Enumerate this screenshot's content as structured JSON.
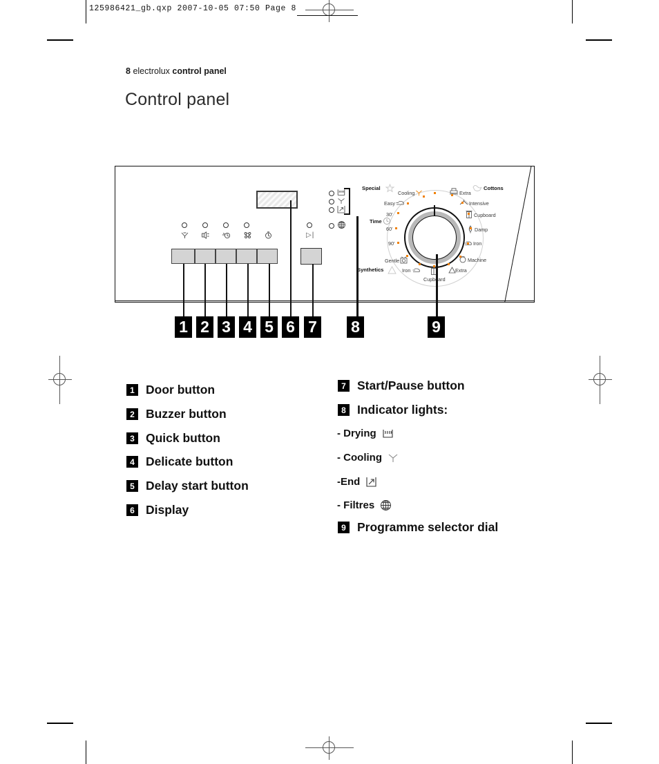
{
  "print_header": {
    "filename_line": "125986421_gb.qxp   2007-10-05   07:50   Page 8"
  },
  "page": {
    "page_number": "8",
    "brand": "electrolux",
    "breadcrumb_section": "control panel",
    "title": "Control panel"
  },
  "panel": {
    "buttons": [
      {
        "name": "door-button",
        "icon": "door-fan-icon"
      },
      {
        "name": "buzzer-button",
        "icon": "buzzer-speaker-icon"
      },
      {
        "name": "quick-button",
        "icon": "quick-clock-icon"
      },
      {
        "name": "delicate-button",
        "icon": "delicate-flower-icon"
      },
      {
        "name": "delay-start-button",
        "icon": "delay-timer-icon"
      }
    ],
    "start_pause": {
      "name": "start-pause-button",
      "glyph": "▷|"
    },
    "display": {
      "name": "display"
    },
    "indicator_lights": [
      {
        "label": "Drying",
        "icon": "drying-icon"
      },
      {
        "label": "Cooling",
        "icon": "cooling-fan-icon"
      },
      {
        "label": "End",
        "icon": "end-arrow-icon"
      },
      {
        "label": "Filtres",
        "icon": "filtres-mesh-icon"
      }
    ]
  },
  "dial": {
    "name": "programme-selector-dial",
    "left_labels": [
      {
        "text": "Special",
        "bold": true
      },
      {
        "text": "Cooling",
        "bold": false
      },
      {
        "text": "Easy",
        "bold": false
      },
      {
        "text": "Time",
        "bold": true
      },
      {
        "text": "30'",
        "bold": false
      },
      {
        "text": "60'",
        "bold": false
      },
      {
        "text": "90'",
        "bold": false
      },
      {
        "text": "Gentle",
        "bold": false
      },
      {
        "text": "Synthetics",
        "bold": true
      },
      {
        "text": "Iron",
        "bold": false
      }
    ],
    "right_labels": [
      {
        "text": "Cottons",
        "bold": true
      },
      {
        "text": "Extra",
        "bold": false
      },
      {
        "text": "Intensive",
        "bold": false
      },
      {
        "text": "Cupboard",
        "bold": false
      },
      {
        "text": "Damp",
        "bold": false
      },
      {
        "text": "Iron",
        "bold": false
      },
      {
        "text": "Machine",
        "bold": false
      },
      {
        "text": "Extra",
        "bold": false
      }
    ],
    "bottom_label": "Cupboard",
    "tick_color": "#f08000"
  },
  "callouts": [
    "1",
    "2",
    "3",
    "4",
    "5",
    "6",
    "7",
    "8",
    "9"
  ],
  "legend": {
    "left": [
      {
        "num": "1",
        "label": "Door button"
      },
      {
        "num": "2",
        "label": "Buzzer button"
      },
      {
        "num": "3",
        "label": "Quick button"
      },
      {
        "num": "4",
        "label": "Delicate button"
      },
      {
        "num": "5",
        "label": "Delay start button"
      },
      {
        "num": "6",
        "label": "Display"
      }
    ],
    "right": [
      {
        "num": "7",
        "label": "Start/Pause button"
      },
      {
        "num": "8",
        "label": "Indicator lights:"
      }
    ],
    "indicator_items": [
      {
        "label": "- Drying",
        "icon": "drying-icon"
      },
      {
        "label": "- Cooling",
        "icon": "cooling-fan-icon"
      },
      {
        "label": "-End",
        "icon": "end-arrow-icon"
      },
      {
        "label": "- Filtres",
        "icon": "filtres-mesh-icon"
      }
    ],
    "right_last": {
      "num": "9",
      "label": "Programme selector dial"
    }
  }
}
